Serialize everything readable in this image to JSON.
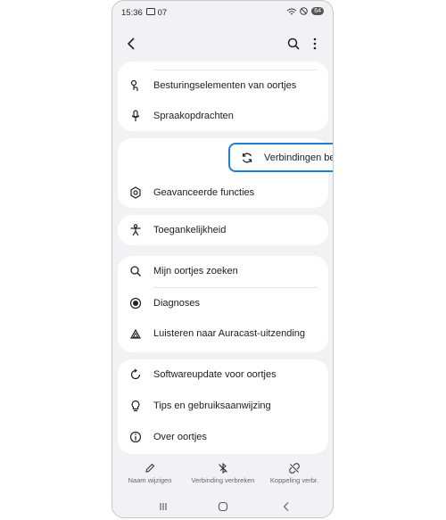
{
  "status_bar": {
    "time": "15:36",
    "extra": "07",
    "battery": "64"
  },
  "header": {
    "back_icon": "back-arrow-icon",
    "search_icon": "search-icon",
    "more_icon": "more-vert-icon"
  },
  "groups": [
    {
      "items": [
        {
          "label": "Besturingselementen van oortjes",
          "icon": "touch-controls-icon"
        },
        {
          "label": "Spraakopdrachten",
          "icon": "microphone-icon"
        }
      ]
    },
    {
      "items": [
        {
          "label": "Verbindingen beheren",
          "icon": "sync-icon",
          "highlighted": true
        },
        {
          "label": "Geavanceerde functies",
          "icon": "advanced-gear-icon"
        }
      ]
    },
    {
      "items": [
        {
          "label": "Toegankelijkheid",
          "icon": "accessibility-icon"
        }
      ]
    },
    {
      "items": [
        {
          "label": "Mijn oortjes zoeken",
          "icon": "search-icon"
        },
        {
          "label": "Diagnoses",
          "icon": "diagnostics-icon"
        },
        {
          "label": "Luisteren naar Auracast-uitzending",
          "icon": "broadcast-icon"
        }
      ]
    },
    {
      "items": [
        {
          "label": "Softwareupdate voor oortjes",
          "icon": "update-icon"
        },
        {
          "label": "Tips en gebruiksaanwijzing",
          "icon": "lightbulb-icon"
        },
        {
          "label": "Over oortjes",
          "icon": "info-icon"
        }
      ]
    }
  ],
  "bottom_actions": [
    {
      "label": "Naam wijzigen",
      "icon": "pencil-icon"
    },
    {
      "label": "Verbinding verbreken",
      "icon": "bluetooth-off-icon"
    },
    {
      "label": "Koppeling verbr.",
      "icon": "unlink-icon"
    }
  ],
  "nav_bar": {
    "recents": "recents-icon",
    "home": "home-icon",
    "back": "back-icon"
  },
  "colors": {
    "highlight": "#1e7fd6",
    "background": "#f2f2f4",
    "card": "#ffffff"
  }
}
